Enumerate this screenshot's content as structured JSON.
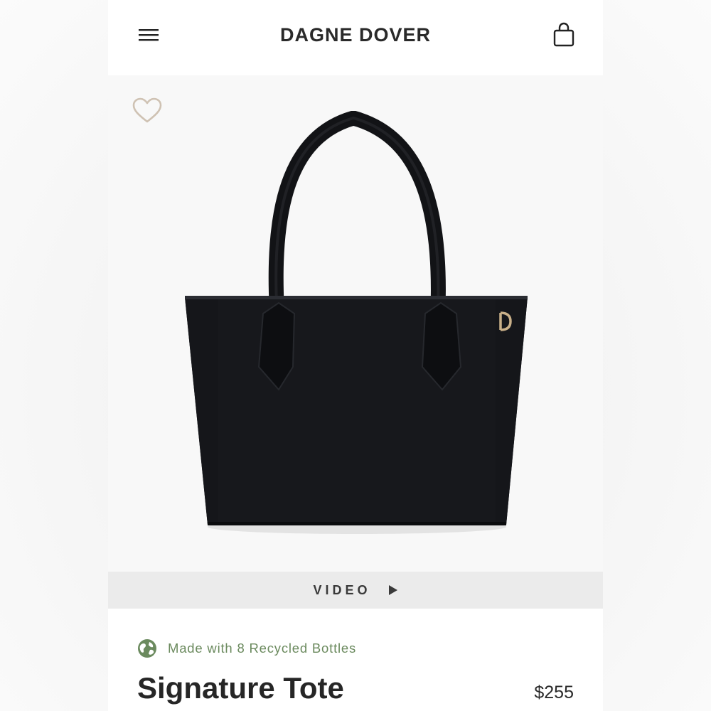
{
  "header": {
    "brand": "DAGNE DOVER",
    "menu_icon": "hamburger-menu-icon",
    "cart_icon": "shopping-bag-icon"
  },
  "gallery": {
    "favorite_icon": "heart-outline-icon",
    "image_subject": "black tote handbag"
  },
  "video_bar": {
    "label": "VIDEO",
    "icon": "play-icon"
  },
  "product": {
    "eco_badge": "Made with 8 Recycled Bottles",
    "eco_icon": "globe-icon",
    "title": "Signature Tote",
    "price": "$255"
  },
  "colors": {
    "brand_text": "#2a2a2a",
    "eco_green": "#6b8a5e",
    "heart_outline": "#cfc2b3",
    "video_bar_bg": "#ebebeb",
    "bag": "#121316"
  }
}
